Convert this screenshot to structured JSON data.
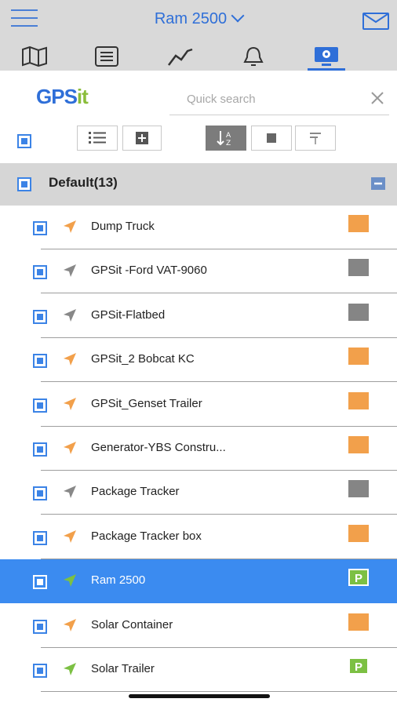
{
  "header": {
    "title": "Ram 2500",
    "tabs": [
      {
        "name": "map-icon",
        "active": false
      },
      {
        "name": "list-icon",
        "active": false
      },
      {
        "name": "chart-icon",
        "active": false
      },
      {
        "name": "bell-icon",
        "active": false
      },
      {
        "name": "monitor-icon",
        "active": true
      }
    ]
  },
  "logo": {
    "text_main": "GPS",
    "text_accent": "it"
  },
  "search": {
    "placeholder": "Quick search",
    "value": ""
  },
  "group": {
    "label": "Default(13)"
  },
  "vehicles": [
    {
      "name": "Dump Truck",
      "arrow_color": "#f2a04b",
      "status": "orange",
      "status_label": ""
    },
    {
      "name": "GPSit -Ford VAT-9060",
      "arrow_color": "#888888",
      "status": "gray",
      "status_label": ""
    },
    {
      "name": "GPSit-Flatbed",
      "arrow_color": "#888888",
      "status": "gray",
      "status_label": ""
    },
    {
      "name": "GPSit_2 Bobcat KC",
      "arrow_color": "#f2a04b",
      "status": "orange",
      "status_label": ""
    },
    {
      "name": "GPSit_Genset Trailer",
      "arrow_color": "#f2a04b",
      "status": "orange",
      "status_label": ""
    },
    {
      "name": "Generator-YBS Constru...",
      "arrow_color": "#f2a04b",
      "status": "orange",
      "status_label": ""
    },
    {
      "name": "Package Tracker",
      "arrow_color": "#888888",
      "status": "gray",
      "status_label": ""
    },
    {
      "name": "Package Tracker box",
      "arrow_color": "#f2a04b",
      "status": "orange",
      "status_label": ""
    },
    {
      "name": "Ram 2500",
      "arrow_color": "#7cc043",
      "status": "park",
      "status_label": "P",
      "selected": true
    },
    {
      "name": "Solar Container",
      "arrow_color": "#f2a04b",
      "status": "orange",
      "status_label": ""
    },
    {
      "name": "Solar Trailer",
      "arrow_color": "#7cc043",
      "status": "park",
      "status_label": "P"
    }
  ]
}
